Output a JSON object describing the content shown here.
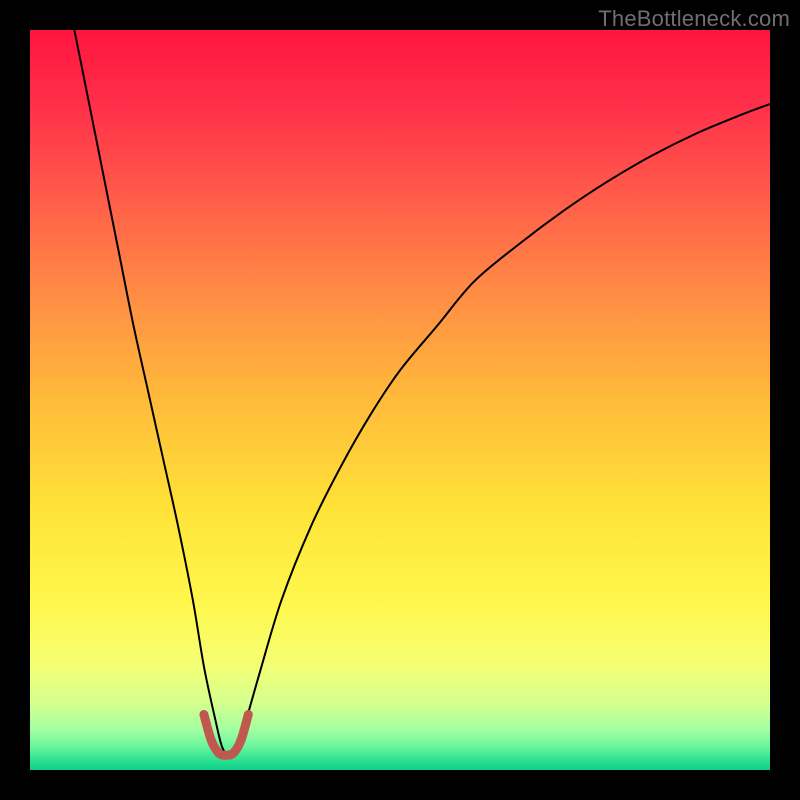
{
  "attribution": "TheBottleneck.com",
  "chart_data": {
    "type": "line",
    "title": "",
    "xlabel": "",
    "ylabel": "",
    "xlim": [
      0,
      100
    ],
    "ylim": [
      0,
      100
    ],
    "grid": false,
    "legend": false,
    "series": [
      {
        "name": "bottleneck-curve",
        "color": "#000000",
        "stroke_width": 2,
        "x": [
          6,
          8,
          10,
          12,
          14,
          16,
          18,
          20,
          22,
          23.5,
          25,
          26,
          27,
          28,
          29,
          31,
          34,
          38,
          42,
          46,
          50,
          55,
          60,
          66,
          72,
          78,
          84,
          90,
          96,
          100
        ],
        "values": [
          100,
          90,
          80,
          70,
          60,
          51,
          42,
          33,
          23,
          14,
          7,
          3,
          2,
          3,
          6,
          13,
          23,
          33,
          41,
          48,
          54,
          60,
          66,
          71,
          75.5,
          79.5,
          83,
          86,
          88.5,
          90
        ]
      },
      {
        "name": "highlight-range",
        "color": "#c0584f",
        "stroke_width": 9,
        "linecap": "round",
        "x": [
          23.5,
          24.5,
          25.5,
          26.5,
          27.5,
          28.5,
          29.5
        ],
        "values": [
          7.5,
          4,
          2.3,
          2,
          2.3,
          4,
          7.5
        ]
      }
    ],
    "background_gradient": {
      "type": "vertical",
      "stops": [
        {
          "pos": 0.0,
          "color": "#ff153e"
        },
        {
          "pos": 0.1,
          "color": "#ff2f4a"
        },
        {
          "pos": 0.22,
          "color": "#ff5a4a"
        },
        {
          "pos": 0.35,
          "color": "#ff8a45"
        },
        {
          "pos": 0.5,
          "color": "#ffbb3a"
        },
        {
          "pos": 0.65,
          "color": "#ffe338"
        },
        {
          "pos": 0.78,
          "color": "#fff84e"
        },
        {
          "pos": 0.86,
          "color": "#f4ff75"
        },
        {
          "pos": 0.91,
          "color": "#d4ff8e"
        },
        {
          "pos": 0.945,
          "color": "#a4ffa0"
        },
        {
          "pos": 0.968,
          "color": "#6cf59d"
        },
        {
          "pos": 0.984,
          "color": "#35e496"
        },
        {
          "pos": 1.0,
          "color": "#0ecf86"
        }
      ]
    }
  }
}
